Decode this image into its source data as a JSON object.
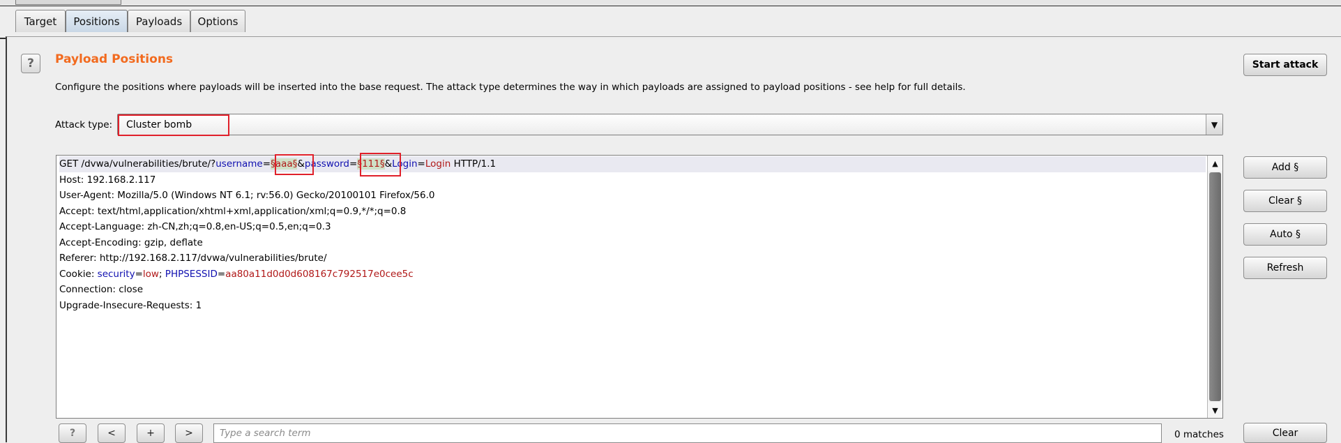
{
  "tabs": [
    {
      "label": "Target",
      "active": false
    },
    {
      "label": "Positions",
      "active": true
    },
    {
      "label": "Payloads",
      "active": false
    },
    {
      "label": "Options",
      "active": false
    }
  ],
  "help_icon_glyph": "?",
  "section": {
    "title": "Payload Positions",
    "description": "Configure the positions where payloads will be inserted into the base request. The attack type determines the way in which payloads are assigned to payload positions - see help for full details."
  },
  "start_attack_label": "Start attack",
  "attack_type": {
    "label": "Attack type:",
    "value": "Cluster bomb"
  },
  "request": {
    "line1": {
      "prefix": "GET /dvwa/vulnerabilities/brute/?",
      "p1_name": "username",
      "eq1": "=",
      "p1_marker": "§aaa§",
      "amp1": "&",
      "p2_name": "password",
      "eq2": "=",
      "p2_marker": "§111§",
      "amp2": "&",
      "p3_name": "Login",
      "eq3": "=",
      "p3_value": "Login",
      "suffix": " HTTP/1.1"
    },
    "host": "Host: 192.168.2.117",
    "user_agent": "User-Agent: Mozilla/5.0 (Windows NT 6.1; rv:56.0) Gecko/20100101 Firefox/56.0",
    "accept": "Accept: text/html,application/xhtml+xml,application/xml;q=0.9,*/*;q=0.8",
    "accept_language": "Accept-Language: zh-CN,zh;q=0.8,en-US;q=0.5,en;q=0.3",
    "accept_encoding": "Accept-Encoding: gzip, deflate",
    "referer": "Referer: http://192.168.2.117/dvwa/vulnerabilities/brute/",
    "cookie": {
      "prefix": "Cookie: ",
      "c1_name": "security",
      "eq1": "=",
      "c1_value": "low",
      "sep": "; ",
      "c2_name": "PHPSESSID",
      "eq2": "=",
      "c2_value": "aa80a11d0d0d608167c792517e0cee5c"
    },
    "connection": "Connection: close",
    "upgrade": "Upgrade-Insecure-Requests: 1"
  },
  "side_buttons": {
    "add": "Add §",
    "clear": "Clear §",
    "auto": "Auto §",
    "refresh": "Refresh"
  },
  "search_bar": {
    "help": "?",
    "prev": "<",
    "add": "+",
    "next": ">",
    "placeholder": "Type a search term",
    "value": "",
    "matches": "0 matches",
    "clear": "Clear"
  }
}
